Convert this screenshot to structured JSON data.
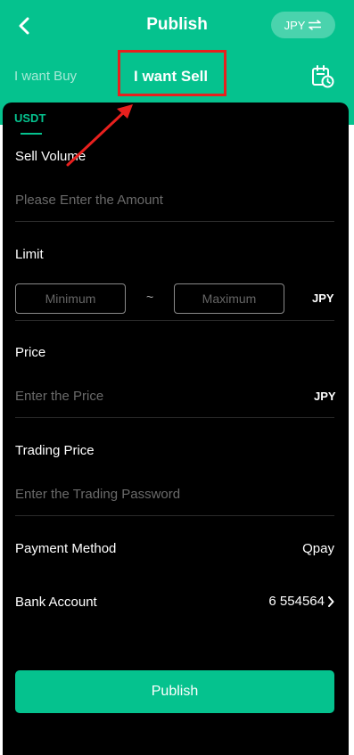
{
  "header": {
    "title": "Publish",
    "currency_label": "JPY",
    "currency_icon": "swap-arrows-icon",
    "back_icon": "chevron-left-icon",
    "history_icon": "calendar-clock-icon"
  },
  "tabs": {
    "buy": "I want Buy",
    "sell": "I want Sell",
    "active": "sell"
  },
  "form": {
    "coin_tab": "USDT",
    "sell_volume": {
      "label": "Sell Volume",
      "placeholder": "Please Enter the Amount"
    },
    "limit": {
      "label": "Limit",
      "min_placeholder": "Minimum",
      "separator": "~",
      "max_placeholder": "Maximum",
      "unit": "JPY"
    },
    "price": {
      "label": "Price",
      "placeholder": "Enter the Price",
      "unit": "JPY"
    },
    "trading_price": {
      "label": "Trading Price",
      "placeholder": "Enter the Trading Password"
    },
    "payment_method": {
      "label": "Payment Method",
      "value": "Qpay"
    },
    "bank_account": {
      "label": "Bank Account",
      "value": "6 554564"
    },
    "submit_label": "Publish"
  },
  "colors": {
    "accent": "#05c28e",
    "annotation": "#e8201e",
    "panel": "#000000"
  }
}
